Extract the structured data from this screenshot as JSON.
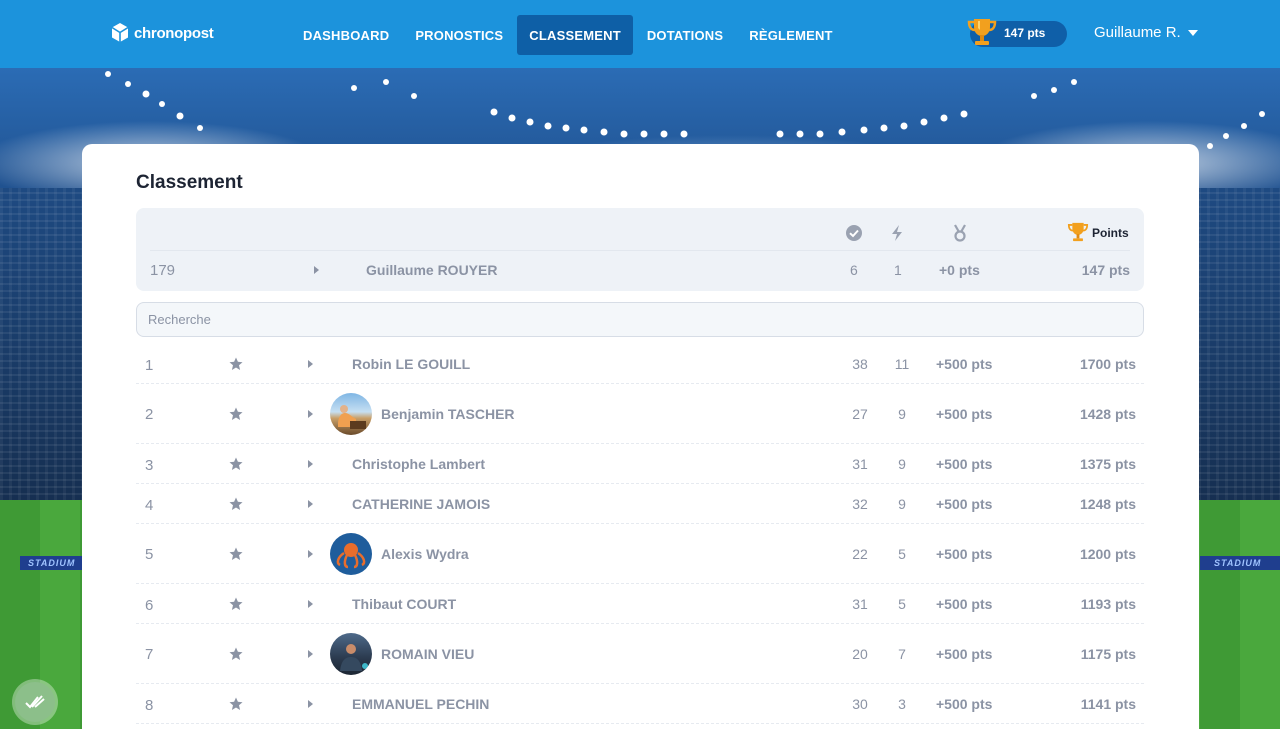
{
  "brand": {
    "name": "chronopost"
  },
  "nav": {
    "items": [
      {
        "label": "DASHBOARD",
        "active": false
      },
      {
        "label": "PRONOSTICS",
        "active": false
      },
      {
        "label": "CLASSEMENT",
        "active": true
      },
      {
        "label": "DOTATIONS",
        "active": false
      },
      {
        "label": "RÈGLEMENT",
        "active": false
      }
    ]
  },
  "user": {
    "points": "147 pts",
    "name": "Guillaume R."
  },
  "stadium": {
    "banner_left": "STADIUM",
    "banner_right": "STADIUM"
  },
  "page": {
    "title": "Classement"
  },
  "table_header": {
    "icons": [
      "check-circle-icon",
      "lightning-icon",
      "medal-icon",
      "trophy-icon"
    ],
    "points_label": "Points"
  },
  "my_rank": {
    "rank": "179",
    "name": "Guillaume ROUYER",
    "correct": "6",
    "bonus": "1",
    "medal_pts": "+0 pts",
    "total": "147 pts"
  },
  "search": {
    "placeholder": "Recherche",
    "value": ""
  },
  "rows": [
    {
      "rank": "1",
      "name": "Robin LE GOUILL",
      "avatar": false,
      "correct": "38",
      "bonus": "11",
      "medal_pts": "+500 pts",
      "total": "1700 pts"
    },
    {
      "rank": "2",
      "name": "Benjamin TASCHER",
      "avatar": true,
      "correct": "27",
      "bonus": "9",
      "medal_pts": "+500 pts",
      "total": "1428 pts"
    },
    {
      "rank": "3",
      "name": "Christophe Lambert",
      "avatar": false,
      "correct": "31",
      "bonus": "9",
      "medal_pts": "+500 pts",
      "total": "1375 pts"
    },
    {
      "rank": "4",
      "name": "CATHERINE JAMOIS",
      "avatar": false,
      "correct": "32",
      "bonus": "9",
      "medal_pts": "+500 pts",
      "total": "1248 pts"
    },
    {
      "rank": "5",
      "name": "Alexis Wydra",
      "avatar": true,
      "correct": "22",
      "bonus": "5",
      "medal_pts": "+500 pts",
      "total": "1200 pts"
    },
    {
      "rank": "6",
      "name": "Thibaut COURT",
      "avatar": false,
      "correct": "31",
      "bonus": "5",
      "medal_pts": "+500 pts",
      "total": "1193 pts"
    },
    {
      "rank": "7",
      "name": "ROMAIN VIEU",
      "avatar": true,
      "correct": "20",
      "bonus": "7",
      "medal_pts": "+500 pts",
      "total": "1175 pts"
    },
    {
      "rank": "8",
      "name": "EMMANUEL PECHIN",
      "avatar": false,
      "correct": "30",
      "bonus": "3",
      "medal_pts": "+500 pts",
      "total": "1141 pts"
    }
  ],
  "colors": {
    "header": "#1c93dc",
    "nav_active": "#0e5fa6",
    "muted_text": "#8b93a4",
    "trophy": "#f2a01e"
  }
}
